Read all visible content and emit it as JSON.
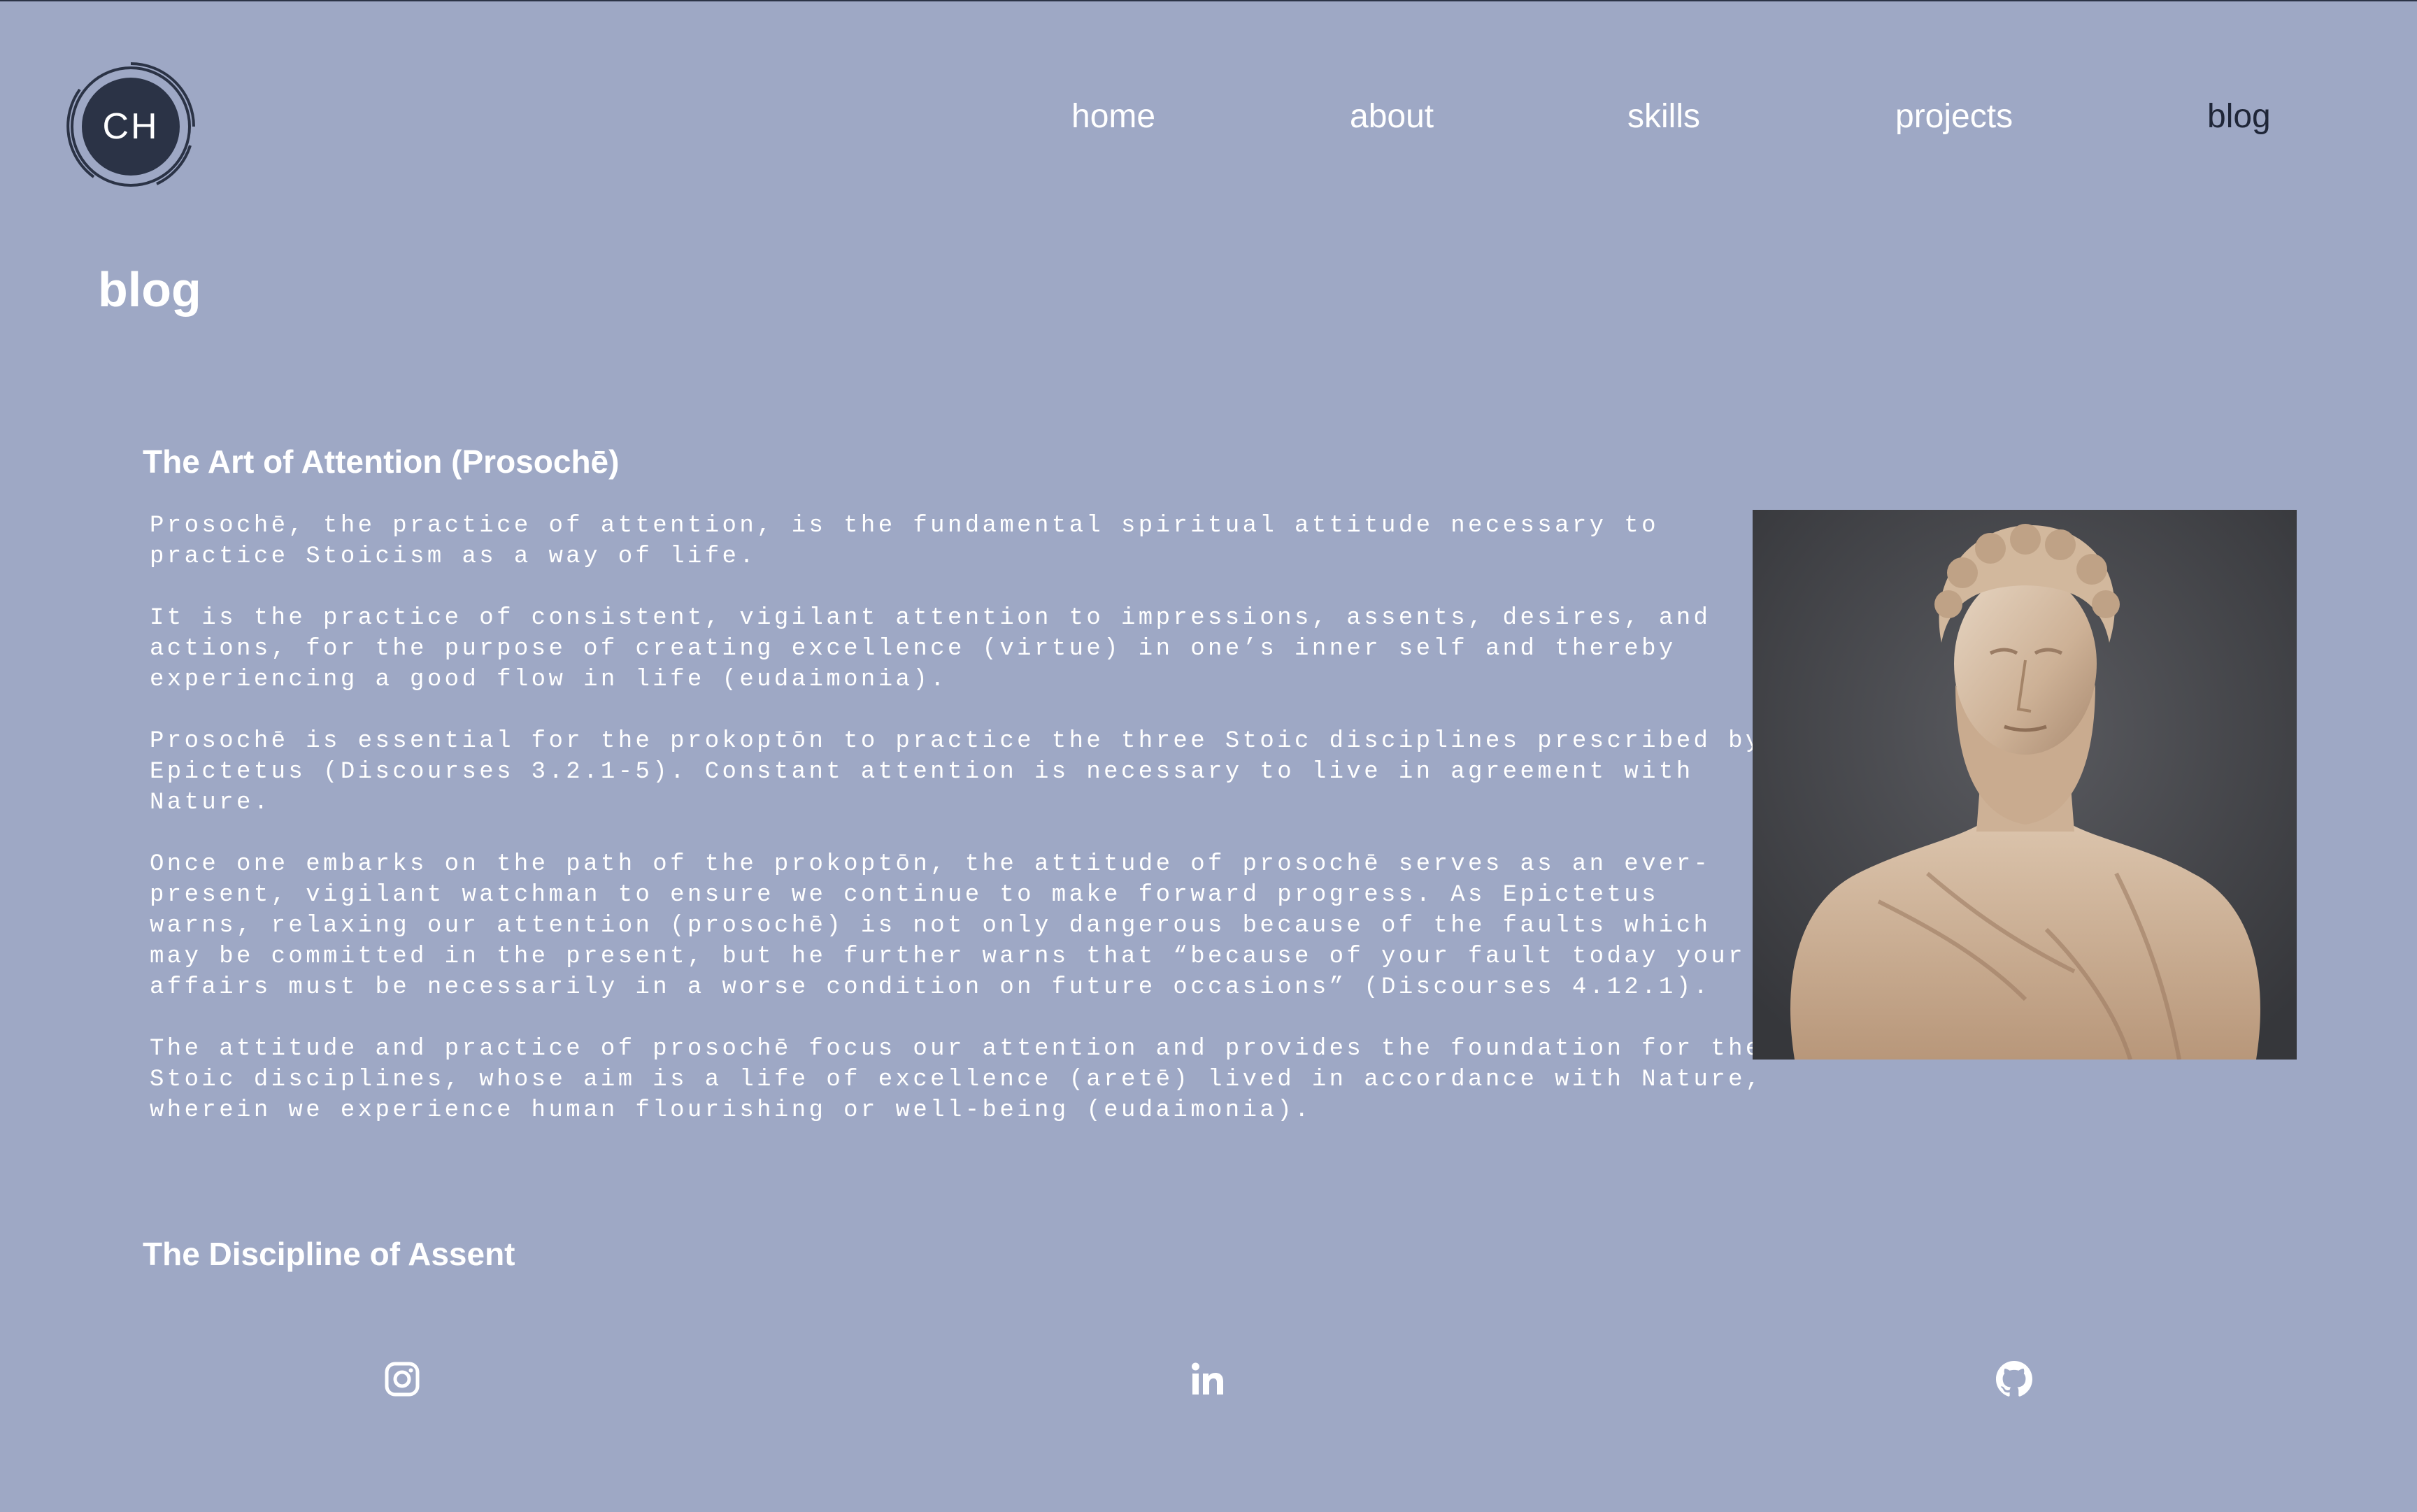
{
  "header": {
    "logo_text": "CH",
    "nav": [
      {
        "label": "home"
      },
      {
        "label": "about"
      },
      {
        "label": "skills"
      },
      {
        "label": "projects"
      },
      {
        "label": "blog",
        "active": true
      }
    ]
  },
  "page": {
    "title": "blog"
  },
  "posts": [
    {
      "title": "The Art of Attention (Prosochē)",
      "paragraphs": [
        "Prosochē, the practice of attention, is the fundamental spiritual attitude necessary to practice Stoicism as a way of life.",
        "It is the practice of consistent, vigilant attention to impressions, assents, desires, and actions, for the purpose of creating excellence (virtue) in one’s inner self and thereby experiencing a good flow in life (eudaimonia).",
        "Prosochē is essential for the prokoptōn to practice the three Stoic disciplines prescribed by Epictetus (Discourses 3.2.1-5). Constant attention is necessary to live in agreement with Nature.",
        "Once one embarks on the path of the prokoptōn, the attitude of prosochē serves as an ever-present, vigilant watchman to ensure we continue to make forward progress. As Epictetus warns, relaxing our attention (prosochē) is not only dangerous because of the faults which may be committed in the present, but he further warns that “because of your fault today your affairs must be necessarily in a worse condition on future occasions” (Discourses 4.12.1).",
        "The attitude and practice of prosochē focus our attention and provides the foundation for the Stoic disciplines, whose aim is a life of excellence (aretē) lived in accordance with Nature, wherein we experience human flourishing or well-being (eudaimonia)."
      ]
    },
    {
      "title": "The Discipline of Assent"
    }
  ],
  "footer": {
    "social": [
      {
        "icon": "instagram-icon"
      },
      {
        "icon": "linkedin-icon"
      },
      {
        "icon": "github-icon"
      }
    ]
  },
  "colors": {
    "background": "#9ea8c5",
    "text": "#ffffff",
    "active_nav": "#1f2638",
    "logo_fill": "#2b3346"
  }
}
